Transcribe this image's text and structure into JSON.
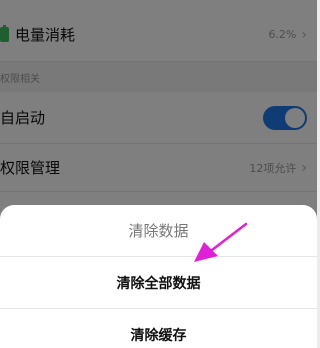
{
  "settings": {
    "battery": {
      "label": "电量消耗",
      "value": "6.2%"
    },
    "section_permissions": "权限相关",
    "autostart": {
      "label": "自启动",
      "enabled": true
    },
    "permission_manage": {
      "label": "权限管理",
      "value": "12项允许"
    }
  },
  "dialog": {
    "title": "清除数据",
    "options": [
      "清除全部数据",
      "清除缓存"
    ]
  },
  "colors": {
    "toggle_on": "#1e78e8",
    "battery_green": "#3fbf5f",
    "annotation_arrow": "#e020d8"
  }
}
